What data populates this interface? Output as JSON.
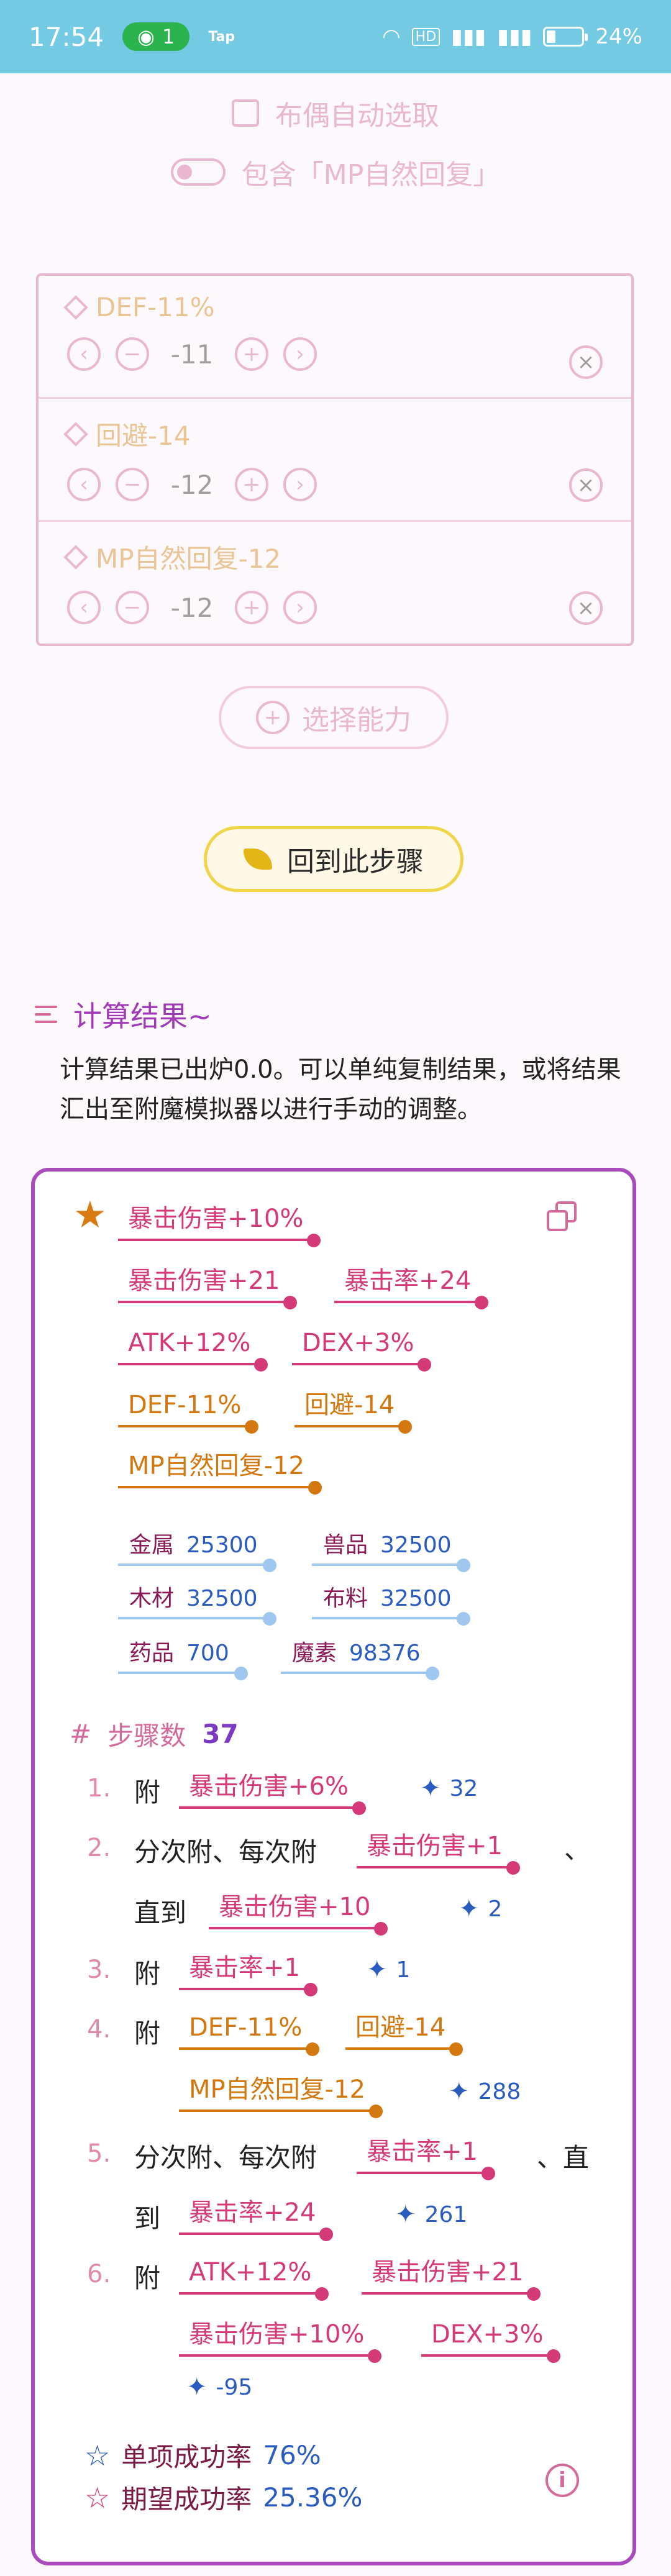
{
  "status_bar": {
    "time": "17:54",
    "hotspot_count": "1",
    "tap_label": "Tap",
    "hd_label": "HD",
    "battery": "24%"
  },
  "options": {
    "auto_select_label": "布偶自动选取",
    "include_mp_label": "包含「MP自然回复」"
  },
  "filters": [
    {
      "label": "DEF-11%",
      "value": "-11"
    },
    {
      "label": "回避-14",
      "value": "-12"
    },
    {
      "label": "MP自然回复-12",
      "value": "-12"
    }
  ],
  "select_ability_label": "选择能力",
  "back_to_step_label": "回到此步骤",
  "results_section": {
    "title": "计算结果~",
    "description": "计算结果已出炉0.0。可以单纯复制结果，或将结果汇出至附魔模拟器以进行手动的调整。"
  },
  "result": {
    "stats": [
      "暴击伤害+10%",
      "暴击伤害+21",
      "暴击率+24",
      "ATK+12%",
      "DEX+3%",
      "DEF-11%",
      "回避-14",
      "MP自然回复-12"
    ],
    "materials": [
      {
        "name": "金属",
        "value": "25300"
      },
      {
        "name": "兽品",
        "value": "32500"
      },
      {
        "name": "木材",
        "value": "32500"
      },
      {
        "name": "布料",
        "value": "32500"
      },
      {
        "name": "药品",
        "value": "700"
      },
      {
        "name": "魔素",
        "value": "98376"
      }
    ],
    "steps_label": "步骤数",
    "steps_count": "37",
    "steps": {
      "s1": {
        "num": "1.",
        "prefix": "附",
        "chip": "暴击伤害+6%",
        "spark": "32"
      },
      "s2": {
        "num": "2.",
        "prefix": "分次附、每次附",
        "chip": "暴击伤害+1",
        "sep": "、",
        "until": "直到",
        "chip2": "暴击伤害+10",
        "spark": "2"
      },
      "s3": {
        "num": "3.",
        "prefix": "附",
        "chip": "暴击率+1",
        "spark": "1"
      },
      "s4": {
        "num": "4.",
        "prefix": "附",
        "chip": "DEF-11%",
        "chip2": "回避-14",
        "chip3": "MP自然回复-12",
        "spark": "288"
      },
      "s5": {
        "num": "5.",
        "prefix": "分次附、每次附",
        "chip": "暴击率+1",
        "sep": "、直",
        "until": "到",
        "chip2": "暴击率+24",
        "spark": "261"
      },
      "s6": {
        "num": "6.",
        "prefix": "附",
        "chip": "ATK+12%",
        "chip2": "暴击伤害+21",
        "chip3": "暴击伤害+10%",
        "chip4": "DEX+3%",
        "spark": "-95"
      }
    },
    "single_success_label": "单项成功率",
    "single_success_value": "76%",
    "expected_success_label": "期望成功率",
    "expected_success_value": "25.36%"
  },
  "colors": {
    "status_bar": "#74c9e3",
    "accent_pink": "#d43a77",
    "accent_orange": "#d2780f",
    "card_border": "#a94bbd",
    "value_blue": "#2a5bbf"
  }
}
